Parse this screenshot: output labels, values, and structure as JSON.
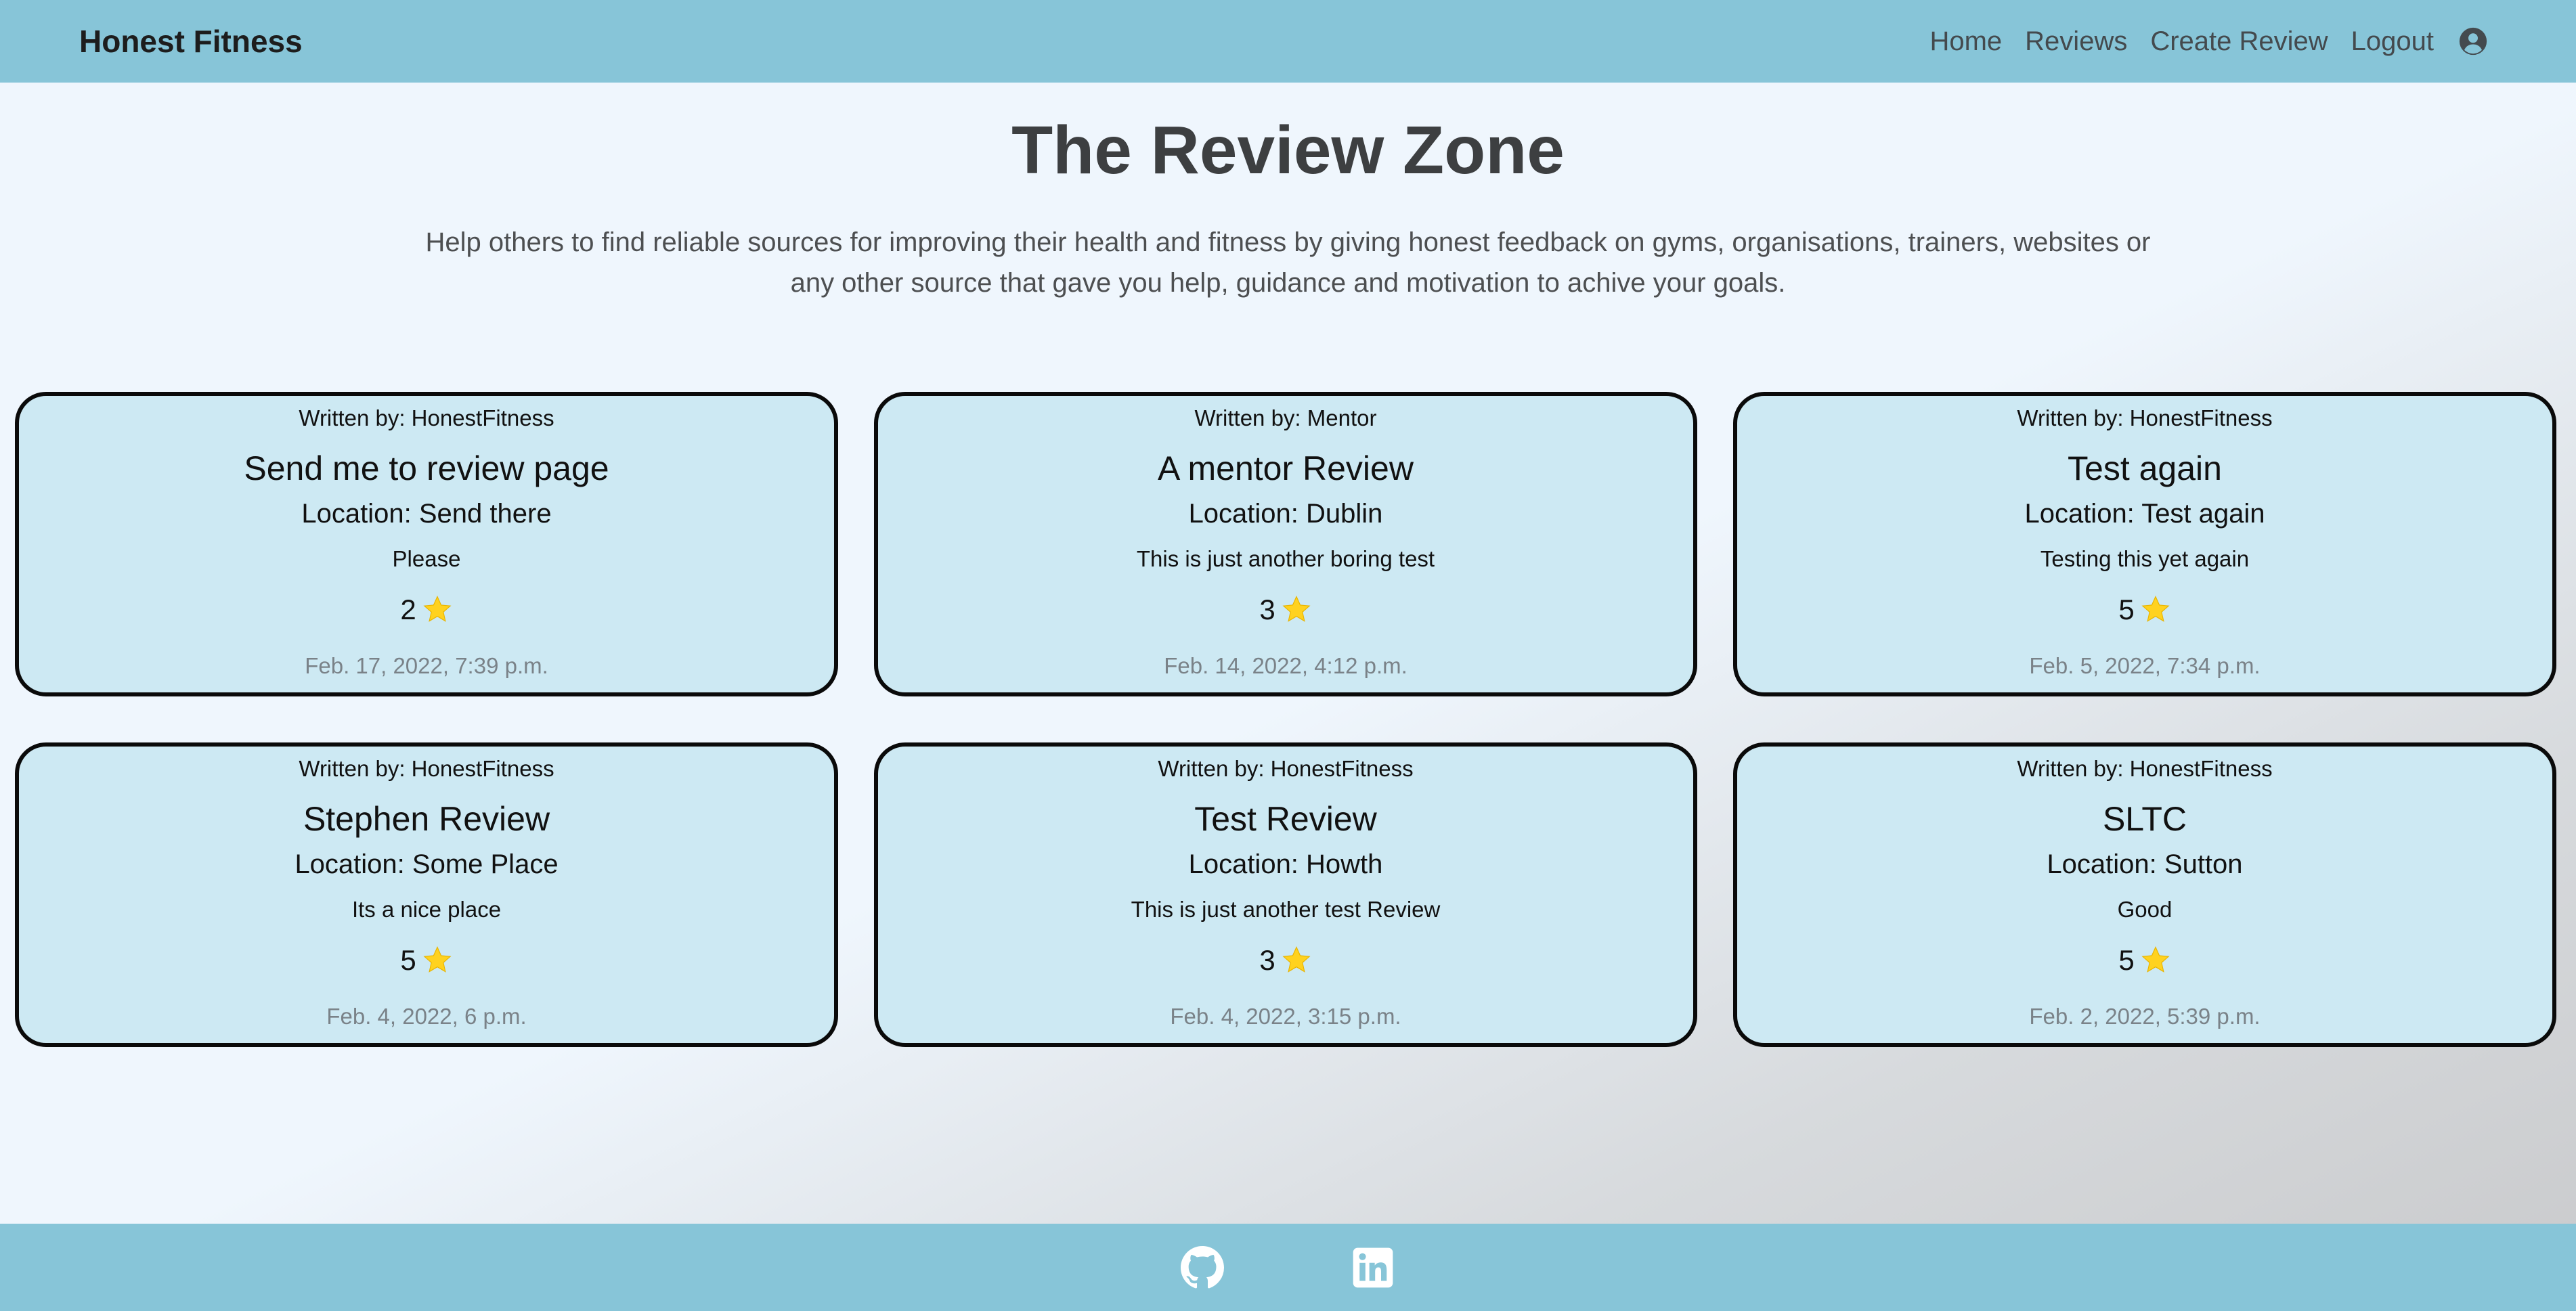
{
  "navbar": {
    "brand": "Honest Fitness",
    "links": {
      "home": "Home",
      "reviews": "Reviews",
      "create_review": "Create Review",
      "logout": "Logout"
    },
    "user_icon": "user-circle-icon"
  },
  "hero": {
    "title": "The Review Zone",
    "subtitle": "Help others to find reliable sources for improving their health and fitness by giving honest feedback on gyms, organisations, trainers, websites or any other source that gave you help, guidance and motivation to achive your goals."
  },
  "reviews": [
    {
      "author": "Written by: HonestFitness",
      "title": "Send me to review page",
      "location": "Location: Send there",
      "body": "Please",
      "rating": "2",
      "date": "Feb. 17, 2022, 7:39 p.m."
    },
    {
      "author": "Written by: Mentor",
      "title": "A mentor Review",
      "location": "Location: Dublin",
      "body": "This is just another boring test",
      "rating": "3",
      "date": "Feb. 14, 2022, 4:12 p.m."
    },
    {
      "author": "Written by: HonestFitness",
      "title": "Test again",
      "location": "Location: Test again",
      "body": "Testing this yet again",
      "rating": "5",
      "date": "Feb. 5, 2022, 7:34 p.m."
    },
    {
      "author": "Written by: HonestFitness",
      "title": "Stephen Review",
      "location": "Location: Some Place",
      "body": "Its a nice place",
      "rating": "5",
      "date": "Feb. 4, 2022, 6 p.m."
    },
    {
      "author": "Written by: HonestFitness",
      "title": "Test Review",
      "location": "Location: Howth",
      "body": "This is just another test Review",
      "rating": "3",
      "date": "Feb. 4, 2022, 3:15 p.m."
    },
    {
      "author": "Written by: HonestFitness",
      "title": "SLTC",
      "location": "Location: Sutton",
      "body": "Good",
      "rating": "5",
      "date": "Feb. 2, 2022, 5:39 p.m."
    }
  ],
  "icons": {
    "rating": "star-icon",
    "footer_left": "github-icon",
    "footer_right": "linkedin-icon"
  },
  "colors": {
    "navbar": "#87c5d8",
    "card_background": "#cde9f3",
    "star": "#ffd21f",
    "page_background": "#eff6fd"
  }
}
